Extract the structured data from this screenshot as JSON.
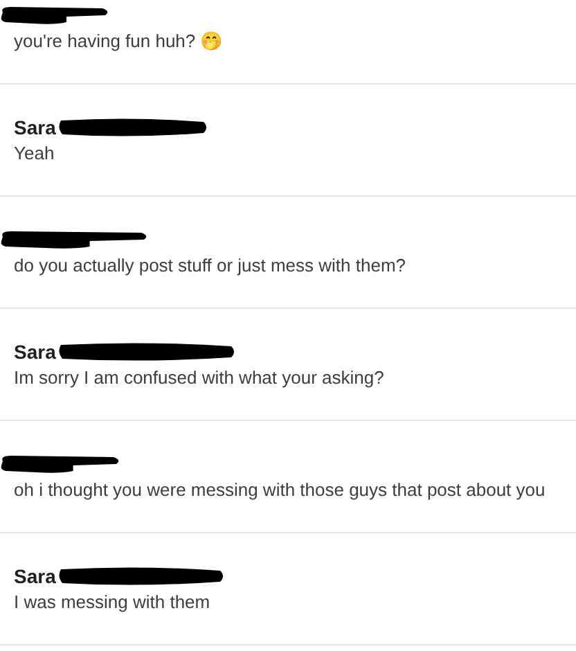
{
  "messages": [
    {
      "text": "you're having fun huh? 🤭"
    },
    {
      "sender": "Sara",
      "text": "Yeah"
    },
    {
      "text": "do you actually post stuff or just mess with them?"
    },
    {
      "sender": "Sara",
      "text": "Im sorry I am confused with what your asking?"
    },
    {
      "text": "oh i thought you were messing with those guys that post about you"
    },
    {
      "sender": "Sara",
      "text": "I was messing with them"
    }
  ]
}
